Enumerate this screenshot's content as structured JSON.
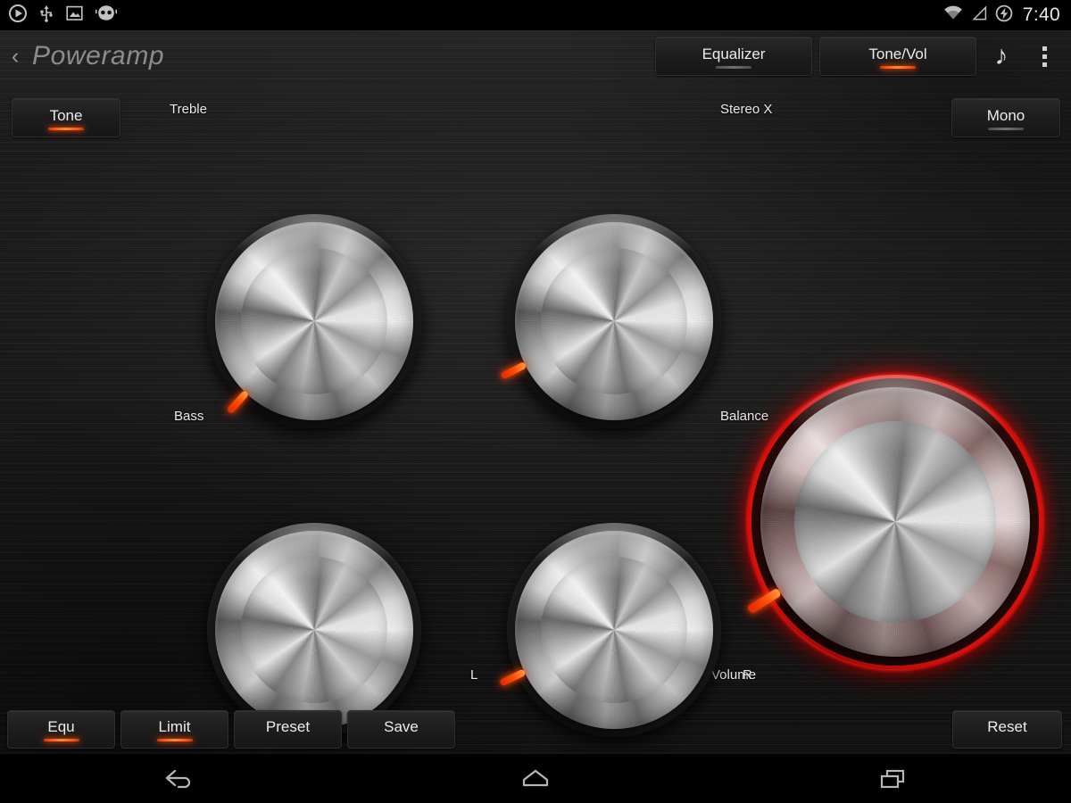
{
  "statusbar": {
    "icons": [
      "play-icon",
      "usb-icon",
      "screenshot-icon",
      "cyanogenmod-icon"
    ],
    "wifi_icon": "wifi-icon",
    "signal_icon": "signal-icon",
    "battery_icon": "battery-charging-icon",
    "clock": "7:40"
  },
  "actionbar": {
    "back_icon": "back-chevron-icon",
    "title": "Poweramp",
    "tabs": [
      {
        "label": "Equalizer",
        "state": "inactive"
      },
      {
        "label": "Tone/Vol",
        "state": "active"
      }
    ],
    "note_icon": "music-note-icon",
    "overflow_icon": "overflow-menu-icon"
  },
  "controls": {
    "tone_button": {
      "label": "Tone",
      "state": "active"
    },
    "mono_button": {
      "label": "Mono",
      "state": "inactive"
    }
  },
  "knobs": [
    {
      "name": "treble",
      "label": "Treble",
      "angle": -138,
      "highlight": false
    },
    {
      "name": "stereo-x",
      "label": "Stereo X",
      "angle": -117,
      "highlight": false
    },
    {
      "name": "bass",
      "label": "Bass",
      "angle": -158,
      "highlight": false
    },
    {
      "name": "balance",
      "label": "Balance",
      "angle": -116,
      "highlight": false
    },
    {
      "name": "volume",
      "label": "Volume",
      "angle": -122,
      "highlight": true
    }
  ],
  "channel_labels": {
    "left": "L",
    "right": "R"
  },
  "bottombar": {
    "buttons": [
      {
        "label": "Equ",
        "state": "active"
      },
      {
        "label": "Limit",
        "state": "active"
      },
      {
        "label": "Preset",
        "state": "none"
      },
      {
        "label": "Save",
        "state": "none"
      }
    ],
    "reset": {
      "label": "Reset",
      "state": "none"
    }
  },
  "navbar": {
    "back_icon": "nav-back-icon",
    "home_icon": "nav-home-icon",
    "recents_icon": "nav-recents-icon"
  },
  "colors": {
    "accent": "#ff5412",
    "glow_ring": "#d8100c",
    "text": "#ededed",
    "panel": "#181818"
  }
}
